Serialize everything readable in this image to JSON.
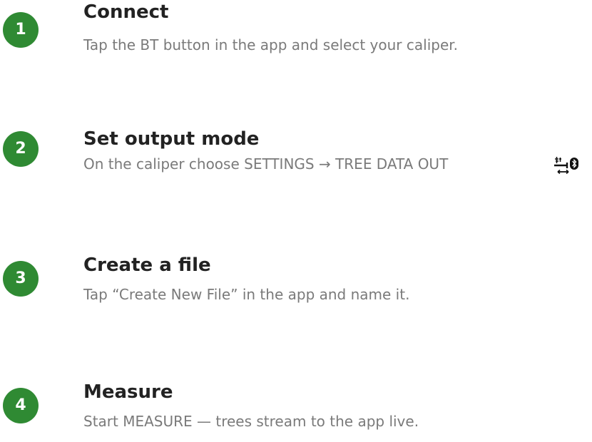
{
  "colors": {
    "badge": "#2f8a33",
    "title": "#222222",
    "description": "#7a7a7a"
  },
  "steps": [
    {
      "number": "1",
      "title": "Connect",
      "description": "Tap the BT button in the app and select your caliper."
    },
    {
      "number": "2",
      "title": "Set output mode",
      "description": "On the caliper choose SETTINGS → TREE DATA OUT",
      "icon": "tree-data-out-bluetooth-icon"
    },
    {
      "number": "3",
      "title": "Create a file",
      "description": "Tap “Create New File” in the app and name it."
    },
    {
      "number": "4",
      "title": "Measure",
      "description": "Start MEASURE — trees stream to the app live."
    }
  ]
}
